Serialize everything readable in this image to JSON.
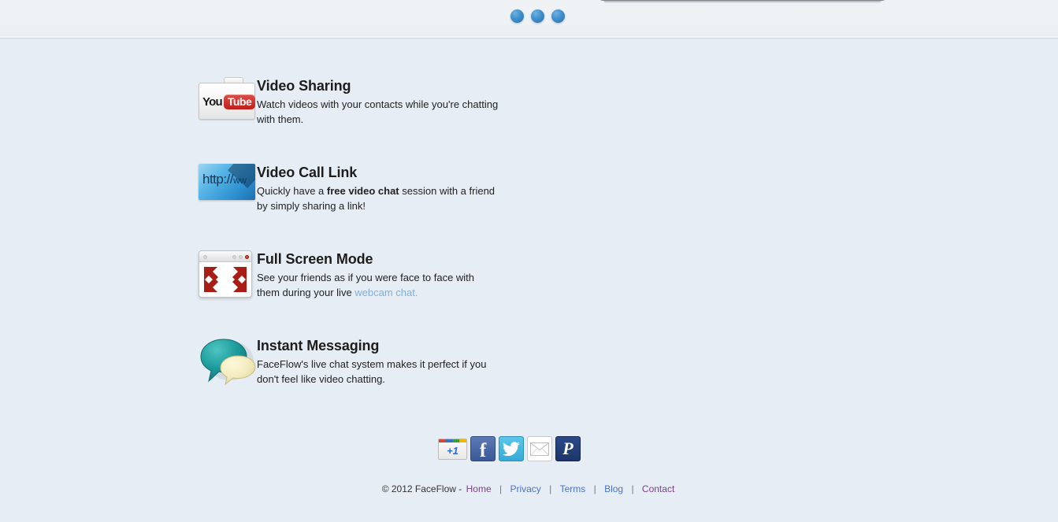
{
  "page": {
    "background_top": "#eef2f5",
    "background_main": "#e6edf4",
    "heading_color": "#1d1d1d",
    "body_text_color": "#222222",
    "link_color": "#7fb0dd"
  },
  "hero": {
    "laptop_image_alt": "laptop-bottom-edge",
    "carousel": {
      "dot_color": "#3e8fcc",
      "dots": [
        "slide-1",
        "slide-2",
        "slide-3"
      ],
      "active_index": 1
    }
  },
  "features": [
    {
      "icon": "youtube-folder-icon",
      "title": "Video Sharing",
      "desc_parts": [
        {
          "type": "text",
          "text": "Watch videos with your contacts while you're chatting with them."
        }
      ],
      "icon_text": {
        "you": "You",
        "tube": "Tube"
      }
    },
    {
      "icon": "http-link-icon",
      "title": "Video Call Link",
      "desc_parts": [
        {
          "type": "text",
          "text": "Quickly have a "
        },
        {
          "type": "bold",
          "text": "free video chat"
        },
        {
          "type": "text",
          "text": " session with a friend by simply sharing a link!"
        }
      ],
      "icon_text": {
        "url": "http://",
        "url_small": "ww"
      }
    },
    {
      "icon": "fullscreen-window-icon",
      "title": "Full Screen Mode",
      "desc_parts": [
        {
          "type": "text",
          "text": "See your friends as if you were face to face with them during your live "
        },
        {
          "type": "link",
          "text": "webcam chat."
        }
      ]
    },
    {
      "icon": "chat-bubbles-icon",
      "title": "Instant Messaging",
      "desc_parts": [
        {
          "type": "text",
          "text": "FaceFlow's live chat system makes it perfect if you don't feel like video chatting."
        }
      ]
    }
  ],
  "share_buttons": [
    {
      "name": "google-plus-one-button",
      "label": "+1",
      "color": "#ffffff"
    },
    {
      "name": "facebook-share-button",
      "label": "f",
      "color": "#3b5998"
    },
    {
      "name": "twitter-share-button",
      "label": "twitter-bird",
      "color": "#35aad6"
    },
    {
      "name": "email-share-button",
      "label": "envelope",
      "color": "#ffffff"
    },
    {
      "name": "pinterest-share-button",
      "label": "P",
      "color": "#1d3569"
    }
  ],
  "footer": {
    "copyright": "© 2012 FaceFlow -",
    "separator": "|",
    "links": [
      {
        "label": "Home",
        "visited": true
      },
      {
        "label": "Privacy",
        "visited": false
      },
      {
        "label": "Terms",
        "visited": false
      },
      {
        "label": "Blog",
        "visited": false
      },
      {
        "label": "Contact",
        "visited": true
      }
    ]
  }
}
